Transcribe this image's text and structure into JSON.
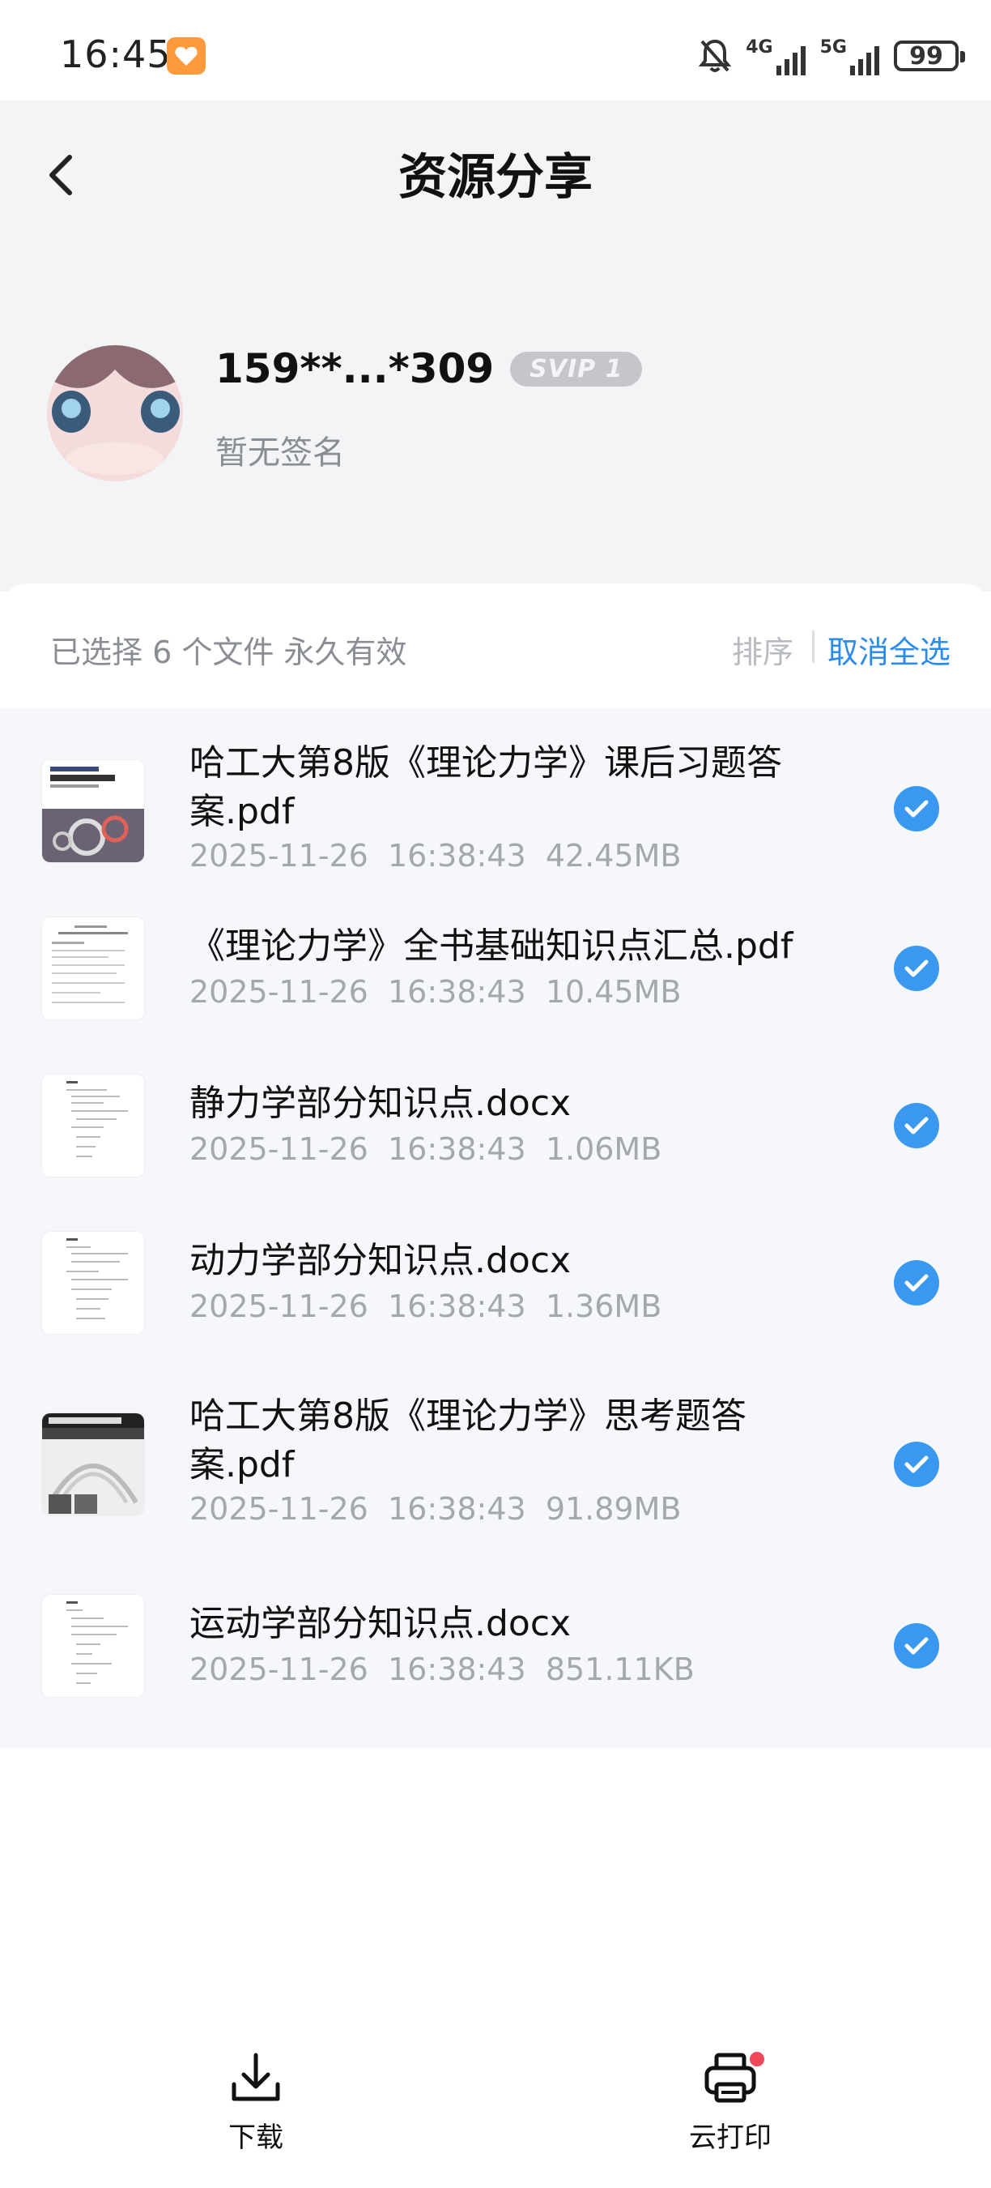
{
  "status_bar": {
    "time": "16:45",
    "net1": "4G",
    "net2": "5G",
    "battery": "99"
  },
  "header": {
    "title": "资源分享"
  },
  "profile": {
    "name": "159**...*309",
    "vip": "SVIP 1",
    "signature": "暂无签名"
  },
  "selection": {
    "info": "已选择 6 个文件 永久有效",
    "sort_label": "排序",
    "deselect_label": "取消全选"
  },
  "files": [
    {
      "name": "哈工大第8版《理论力学》课后习题答案.pdf",
      "meta": "2025-11-26  16:38:43  42.45MB",
      "thumb": "book-cover"
    },
    {
      "name": "《理论力学》全书基础知识点汇总.pdf",
      "meta": "2025-11-26  16:38:43  10.45MB",
      "thumb": "document"
    },
    {
      "name": "静力学部分知识点.docx",
      "meta": "2025-11-26  16:38:43  1.06MB",
      "thumb": "document"
    },
    {
      "name": "动力学部分知识点.docx",
      "meta": "2025-11-26  16:38:43  1.36MB",
      "thumb": "document"
    },
    {
      "name": "哈工大第8版《理论力学》思考题答案.pdf",
      "meta": "2025-11-26  16:38:43  91.89MB",
      "thumb": "book-cover-dark"
    },
    {
      "name": "运动学部分知识点.docx",
      "meta": "2025-11-26  16:38:43  851.11KB",
      "thumb": "document"
    }
  ],
  "bottom_bar": {
    "download_label": "下载",
    "print_label": "云打印"
  },
  "colors": {
    "accent": "#2d8bea",
    "check": "#3a98f0",
    "badge_dot": "#f0465a"
  }
}
